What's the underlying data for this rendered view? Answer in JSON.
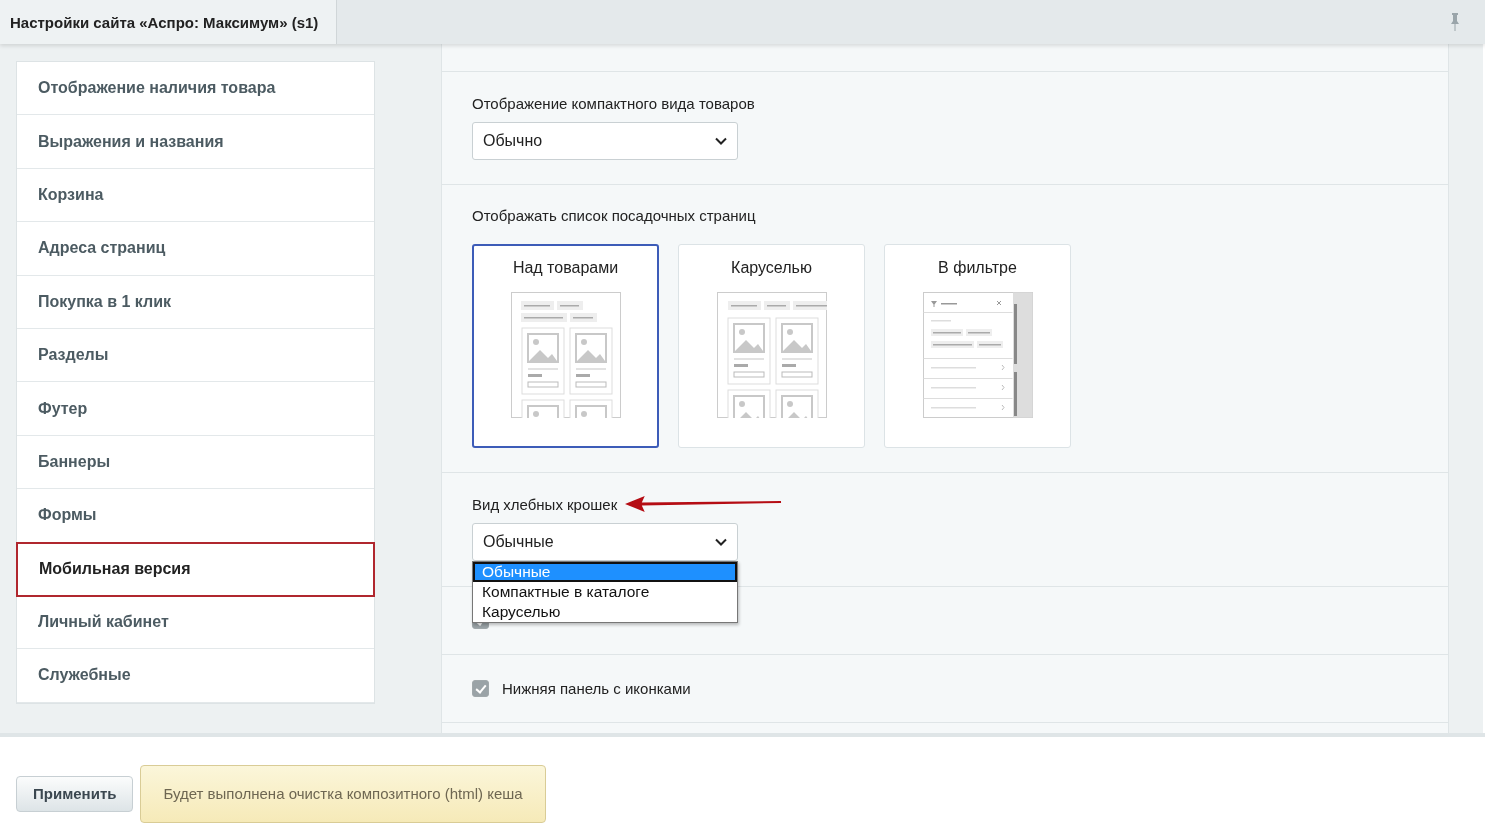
{
  "window": {
    "title": "Настройки сайта «Аспро: Максимум» (s1)"
  },
  "sidebar": {
    "items": [
      {
        "label": "Отображение наличия товара",
        "selected": false
      },
      {
        "label": "Выражения и названия",
        "selected": false
      },
      {
        "label": "Корзина",
        "selected": false
      },
      {
        "label": "Адреса страниц",
        "selected": false
      },
      {
        "label": "Покупка в 1 клик",
        "selected": false
      },
      {
        "label": "Разделы",
        "selected": false
      },
      {
        "label": "Футер",
        "selected": false
      },
      {
        "label": "Баннеры",
        "selected": false
      },
      {
        "label": "Формы",
        "selected": false
      },
      {
        "label": "Мобильная версия",
        "selected": true
      },
      {
        "label": "Личный кабинет",
        "selected": false
      },
      {
        "label": "Служебные",
        "selected": false
      }
    ]
  },
  "settings": [
    {
      "kind": "select",
      "label": "Отображение компактного вида товаров",
      "value": "Обычно"
    },
    {
      "kind": "cards",
      "label": "Отображать список посадочных страниц",
      "options": [
        {
          "label": "Над товарами",
          "kind": "grid",
          "selected": true
        },
        {
          "label": "Каруселью",
          "kind": "carousel",
          "selected": false
        },
        {
          "label": "В фильтре",
          "kind": "filter",
          "selected": false
        }
      ]
    },
    {
      "kind": "select",
      "label": "Вид хлебных крошек",
      "value": "Обычные",
      "open": true,
      "annotated": true,
      "options": [
        {
          "label": "Обычные",
          "selected": true
        },
        {
          "label": "Компактные в каталоге",
          "selected": false
        },
        {
          "label": "Каруселью",
          "selected": false
        }
      ]
    },
    {
      "kind": "checkbox",
      "checked": true
    },
    {
      "kind": "checkbox",
      "label": "Нижняя панель с иконками",
      "checked": true
    }
  ],
  "footer": {
    "apply_button": "Применить",
    "notice": "Будет выполнена очистка композитного (html) кеша"
  }
}
